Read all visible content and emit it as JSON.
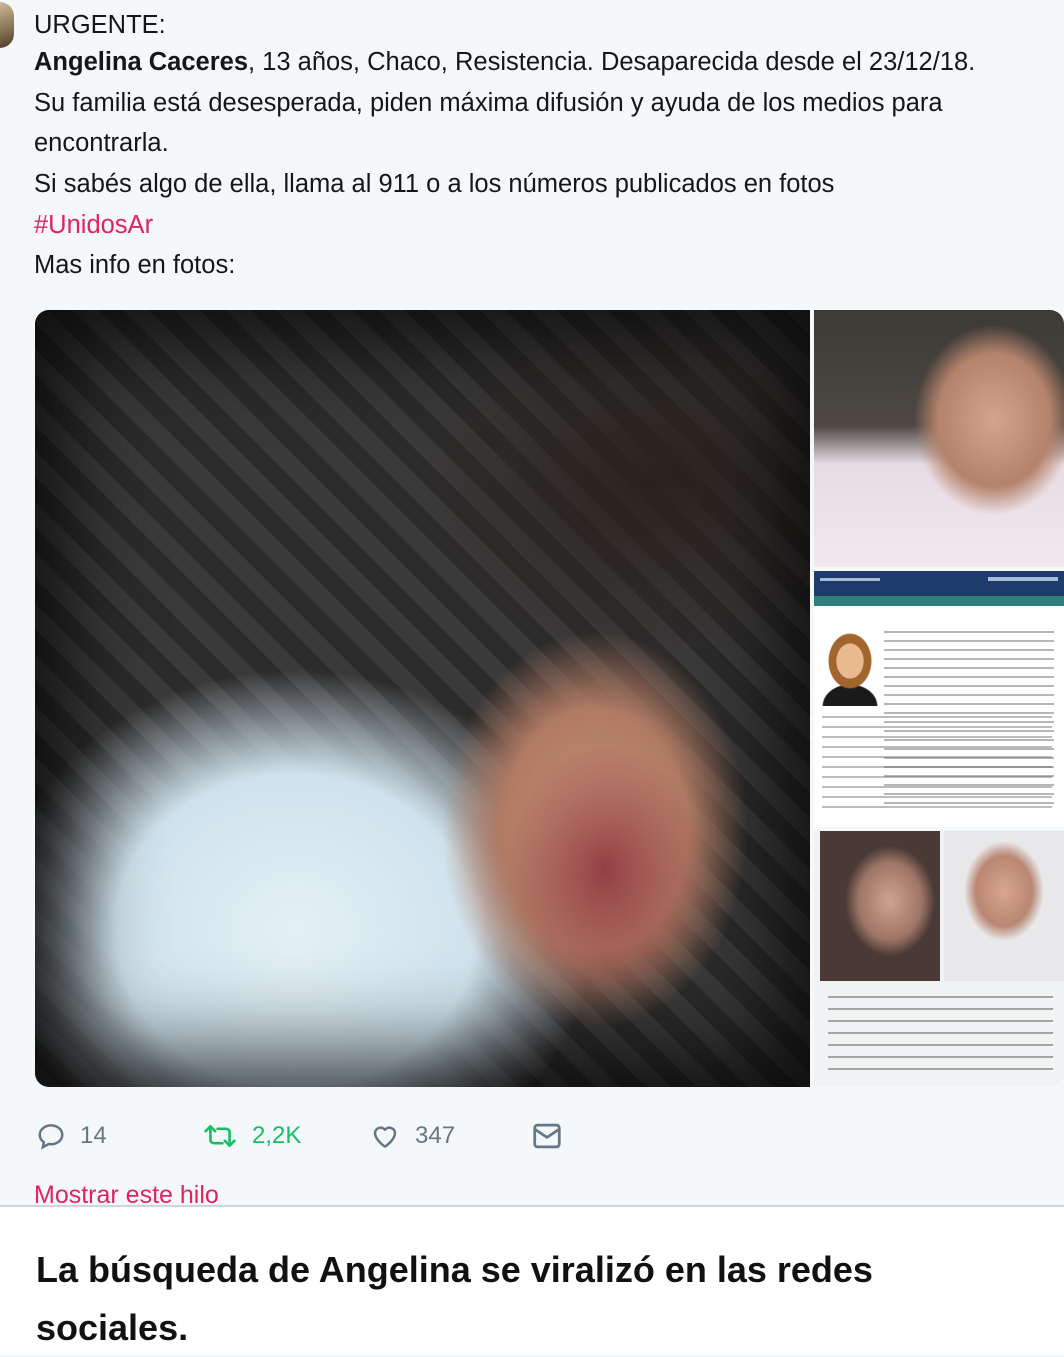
{
  "tweet": {
    "heading": "URGENTE:",
    "name": "Angelina Caceres",
    "line1_rest": ", 13 años, Chaco, Resistencia. Desaparecida desde el 23/12/18.",
    "line2": "Su familia está desesperada, piden máxima difusión y ayuda de los medios para",
    "line3": "encontrarla.",
    "line4": "Si sabés algo de ella, llama al 911 o a los números publicados en fotos",
    "hashtag": "#UnidosAr",
    "line6": "Mas info en fotos:"
  },
  "actions": {
    "replies": "14",
    "retweets": "2,2K",
    "likes": "347",
    "icons": [
      "reply-icon",
      "retweet-icon",
      "like-icon",
      "message-icon"
    ]
  },
  "show_thread": "Mostrar este hilo",
  "caption": "La búsqueda de Angelina se viralizó en las redes sociales.",
  "colors": {
    "hashtag": "#e0245e",
    "retweet": "#17bf63",
    "muted": "#657786",
    "background": "#f5f8fa"
  }
}
